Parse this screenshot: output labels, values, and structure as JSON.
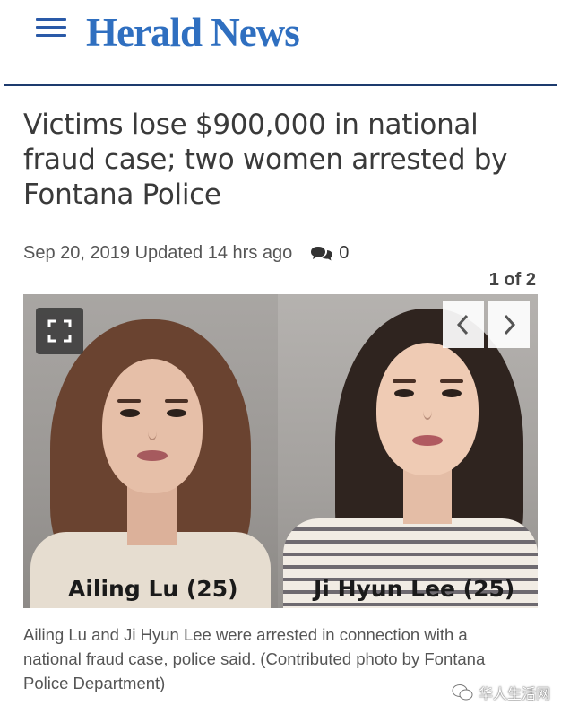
{
  "header": {
    "logo": "Herald News"
  },
  "article": {
    "headline": "Victims lose $900,000 in national fraud case; two women arrested by Fontana Police",
    "date": "Sep 20, 2019",
    "updated": "Updated 14 hrs ago",
    "comment_count": "0"
  },
  "gallery": {
    "counter": "1 of 2",
    "labels": [
      "Ailing Lu (25)",
      "Ji Hyun Lee (25)"
    ],
    "caption": "Ailing Lu and Ji Hyun Lee were arrested in connection with a national fraud case, police said.  (Contributed photo by Fontana Police Department)"
  },
  "watermark": {
    "text": "华人生活网"
  },
  "colors": {
    "brand": "#2f6fc0",
    "header_rule": "#1d3b6e",
    "headline": "#3a3a3a"
  },
  "icons": [
    "menu-icon",
    "comment-icon",
    "fullscreen-icon",
    "chevron-left-icon",
    "chevron-right-icon",
    "wechat-icon"
  ]
}
